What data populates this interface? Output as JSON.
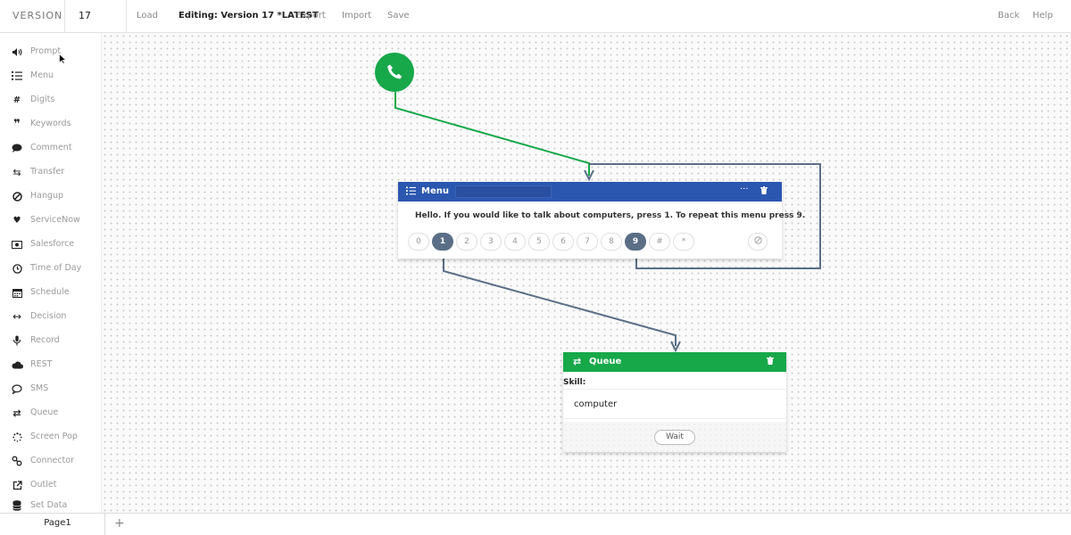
{
  "topbar": {
    "version_label": "VERSION",
    "version_value": "17",
    "load": "Load",
    "editing": "Editing: Version 17 *LATEST",
    "export": "Export",
    "import": "Import",
    "save": "Save",
    "back": "Back",
    "help": "Help"
  },
  "sidebar": {
    "items": [
      {
        "label": "Prompt",
        "icon": "speaker-icon"
      },
      {
        "label": "Menu",
        "icon": "list-icon"
      },
      {
        "label": "Digits",
        "icon": "hash-icon"
      },
      {
        "label": "Keywords",
        "icon": "quote-icon"
      },
      {
        "label": "Comment",
        "icon": "speech-bubble-icon"
      },
      {
        "label": "Transfer",
        "icon": "transfer-arrows-icon"
      },
      {
        "label": "Hangup",
        "icon": "ban-icon"
      },
      {
        "label": "ServiceNow",
        "icon": "heart-icon"
      },
      {
        "label": "Salesforce",
        "icon": "money-icon"
      },
      {
        "label": "Time of Day",
        "icon": "clock-icon"
      },
      {
        "label": "Schedule",
        "icon": "calendar-icon"
      },
      {
        "label": "Decision",
        "icon": "double-arrow-icon"
      },
      {
        "label": "Record",
        "icon": "microphone-icon"
      },
      {
        "label": "REST",
        "icon": "cloud-icon"
      },
      {
        "label": "SMS",
        "icon": "chat-icon"
      },
      {
        "label": "Queue",
        "icon": "queue-icon"
      },
      {
        "label": "Screen Pop",
        "icon": "spinner-icon"
      },
      {
        "label": "Connector",
        "icon": "link-icon"
      },
      {
        "label": "Outlet",
        "icon": "external-link-icon"
      },
      {
        "label": "Set Data",
        "icon": "database-icon"
      }
    ]
  },
  "menu_node": {
    "title": "Menu",
    "more": "···",
    "prompt_text": "Hello. If you would like to talk about computers, press 1. To repeat this menu press 9.",
    "digits": [
      "0",
      "1",
      "2",
      "3",
      "4",
      "5",
      "6",
      "7",
      "8",
      "9",
      "#",
      "*"
    ],
    "active_digits": [
      "1",
      "9"
    ]
  },
  "queue_node": {
    "title": "Queue",
    "skill_label": "Skill:",
    "skill_value": "computer",
    "wait_button": "Wait"
  },
  "bottom": {
    "page_tab": "Page1",
    "add_tab": "+"
  },
  "colors": {
    "start_green": "#17a84a",
    "menu_blue": "#2b57b0",
    "queue_green": "#17a84a",
    "wire_slate": "#5a6f86"
  }
}
